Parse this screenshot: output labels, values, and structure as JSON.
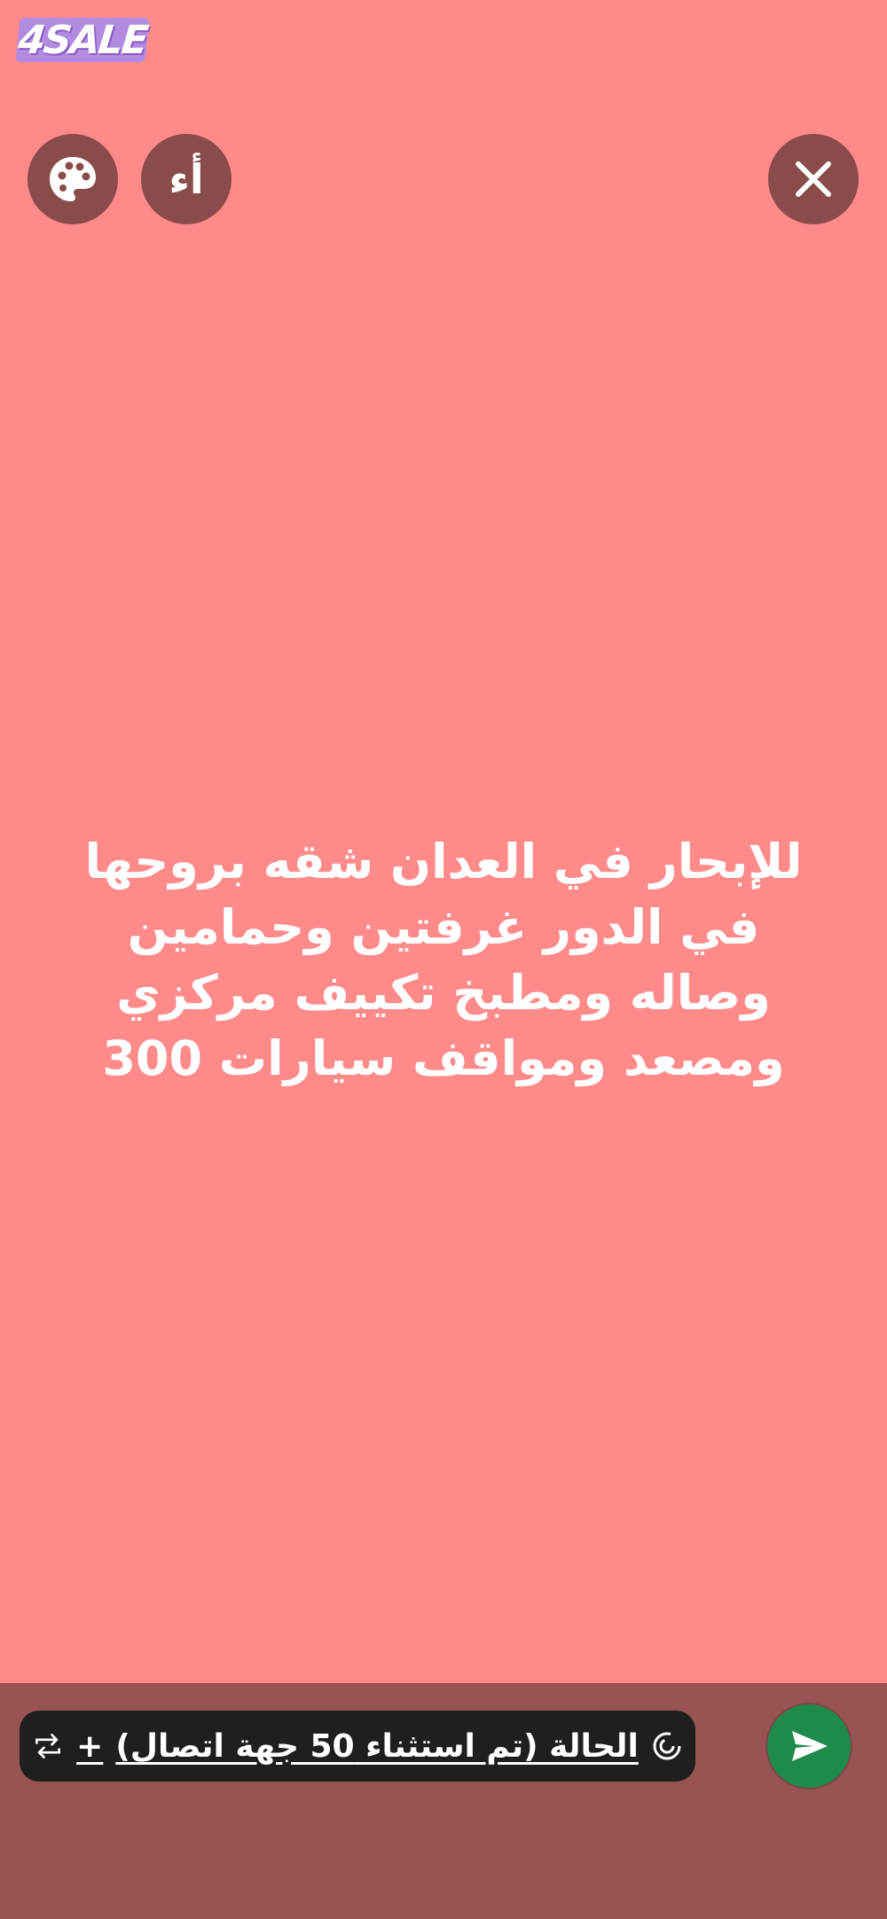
{
  "app": {
    "logo_text": "4SALE",
    "close_icon": "close-icon",
    "font_button_label": "أء",
    "palette_icon": "palette-icon"
  },
  "message": {
    "text": "للإبحار في العدان شقه بروحها في الدور غرفتين وحمامين وصاله ومطبخ تكييف مركزي ومصعد ومواقف سيارات 300"
  },
  "bottom_bar": {
    "status_label": "الحالة (تم استثناء 50 جهة اتصال)",
    "status_icon": "status-ring-icon",
    "add_label": "+",
    "repeat_icon": "repeat-icon",
    "send_icon": "send-icon"
  },
  "colors": {
    "background": "#FF8A8A",
    "button_bg": "#8A4B4B",
    "bottom_bar": "#985353",
    "send_button": "#1E8A4C",
    "logo_bg": "#B08BE0"
  }
}
